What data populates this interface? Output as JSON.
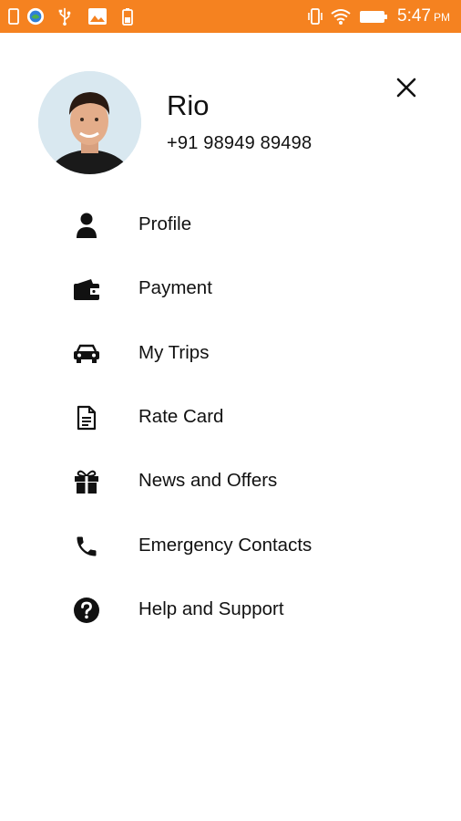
{
  "status_bar": {
    "time": "5:47",
    "ampm": "PM",
    "bg_color": "#f58220",
    "icons": [
      "notification-icon",
      "browser-icon",
      "usb-icon",
      "gallery-icon",
      "battery-saver-icon",
      "vibrate-icon",
      "wifi-icon",
      "battery-icon"
    ]
  },
  "profile": {
    "name": "Rio",
    "phone": "+91 98949 89498"
  },
  "close_icon": "close-icon",
  "menu": {
    "items": [
      {
        "label": "Profile",
        "icon": "person-icon"
      },
      {
        "label": "Payment",
        "icon": "wallet-icon"
      },
      {
        "label": "My Trips",
        "icon": "car-icon"
      },
      {
        "label": "Rate Card",
        "icon": "document-icon"
      },
      {
        "label": "News and Offers",
        "icon": "gift-icon"
      },
      {
        "label": "Emergency Contacts",
        "icon": "phone-icon"
      },
      {
        "label": "Help and Support",
        "icon": "help-icon"
      }
    ]
  }
}
